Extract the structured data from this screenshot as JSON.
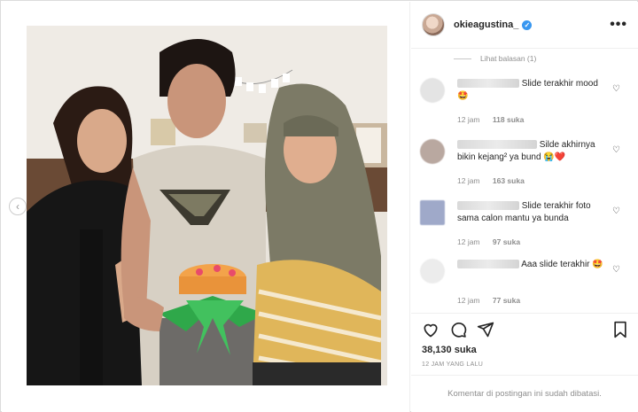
{
  "post": {
    "username": "okieagustina_",
    "more_label": "•••",
    "likes": "38,130 suka",
    "time_ago": "12 JAM YANG LALU",
    "comments_disabled": "Komentar di postingan ini sudah dibatasi."
  },
  "replies_toggle": "Lihat balasan (1)",
  "comments": [
    {
      "text": "Slide terakhir mood",
      "emoji": "🤩",
      "time": "12 jam",
      "likes": "118 suka"
    },
    {
      "text": "Silde akhirnya bikin kejang² ya bund",
      "emoji": "😭❤️",
      "time": "12 jam",
      "likes": "163 suka"
    },
    {
      "text": "Slide terakhir foto sama calon mantu ya bunda",
      "emoji": "",
      "time": "12 jam",
      "likes": "97 suka"
    },
    {
      "text": "Aaa slide terakhir",
      "emoji": "🤩",
      "time": "12 jam",
      "likes": "77 suka"
    }
  ],
  "icons": {
    "like": "heart-icon",
    "comment": "comment-icon",
    "share": "share-icon",
    "save": "bookmark-icon",
    "prev": "chevron-left-icon"
  },
  "colors": {
    "verified": "#3897f0",
    "muted": "#8e8e8e",
    "text": "#262626"
  }
}
